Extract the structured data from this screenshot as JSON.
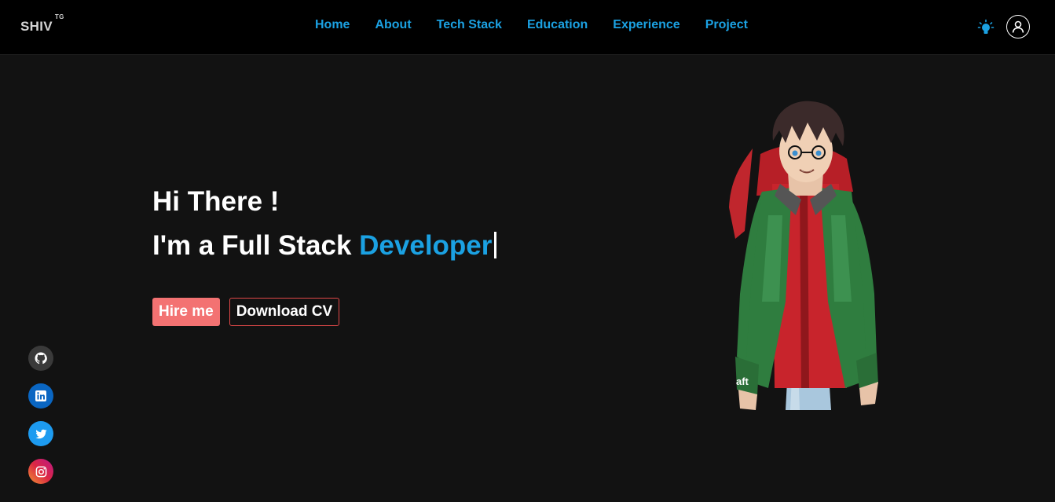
{
  "navbar": {
    "brand": "SHIV",
    "brand_sup": "TG",
    "links": [
      "Home",
      "About",
      "Tech Stack",
      "Education",
      "Experience",
      "Project"
    ],
    "accent_color": "#1ba1e2"
  },
  "hero": {
    "greeting": "Hi There !",
    "role_prefix": "I'm a Full Stack ",
    "role_highlight": "Developer",
    "hire_button": "Hire me",
    "cv_button": "Download CV",
    "hire_color": "#f37272",
    "cv_border_color": "#e04848"
  },
  "avatar": {
    "watermark": "aft"
  },
  "socials": [
    {
      "icon": "github-icon"
    },
    {
      "icon": "linkedin-icon"
    },
    {
      "icon": "twitter-icon"
    },
    {
      "icon": "instagram-icon"
    }
  ],
  "header_icons": [
    "lightbulb-icon",
    "user-icon"
  ]
}
